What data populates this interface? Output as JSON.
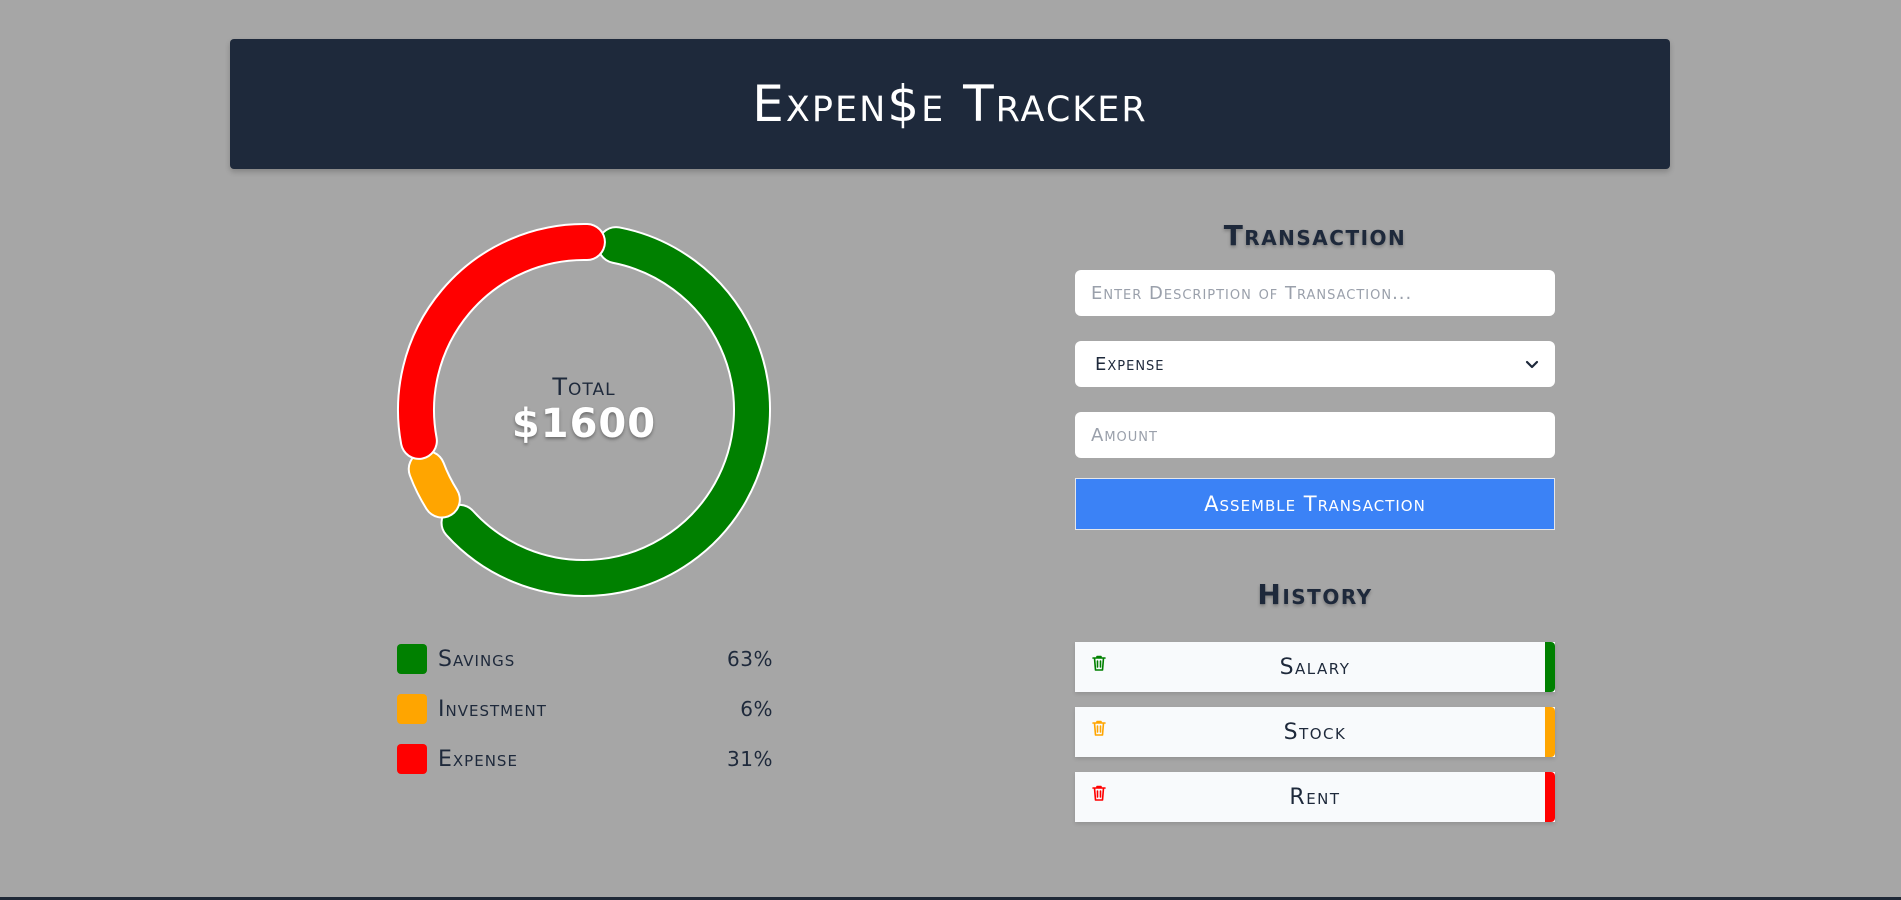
{
  "app": {
    "title": "Expen$e Tracker"
  },
  "summary": {
    "total_label": "Total",
    "total_value": "$1600"
  },
  "chart_data": {
    "type": "pie",
    "style": "donut",
    "categories": [
      "Savings",
      "Investment",
      "Expense"
    ],
    "values": [
      63,
      6,
      31
    ],
    "unit": "%",
    "colors": [
      "#008000",
      "#ffa500",
      "#ff0000"
    ],
    "center_label": "Total",
    "center_value": "$1600"
  },
  "legend": [
    {
      "name": "Savings",
      "percent": "63%",
      "color": "#008000"
    },
    {
      "name": "Investment",
      "percent": "6%",
      "color": "#ffa500"
    },
    {
      "name": "Expense",
      "percent": "31%",
      "color": "#ff0000"
    }
  ],
  "transaction_form": {
    "title": "Transaction",
    "description_placeholder": "Enter Description of Transaction...",
    "type_selected": "Expense",
    "amount_placeholder": "Amount",
    "submit_label": "Assemble Transaction"
  },
  "history": {
    "title": "History",
    "items": [
      {
        "name": "Salary",
        "color": "#008000",
        "icon": "trash-icon"
      },
      {
        "name": "Stock",
        "color": "#ffa500",
        "icon": "trash-icon"
      },
      {
        "name": "Rent",
        "color": "#ff0000",
        "icon": "trash-icon"
      }
    ]
  },
  "colors": {
    "background": "#a6a6a6",
    "header": "#1e293b",
    "accent_button": "#3b82f6"
  }
}
